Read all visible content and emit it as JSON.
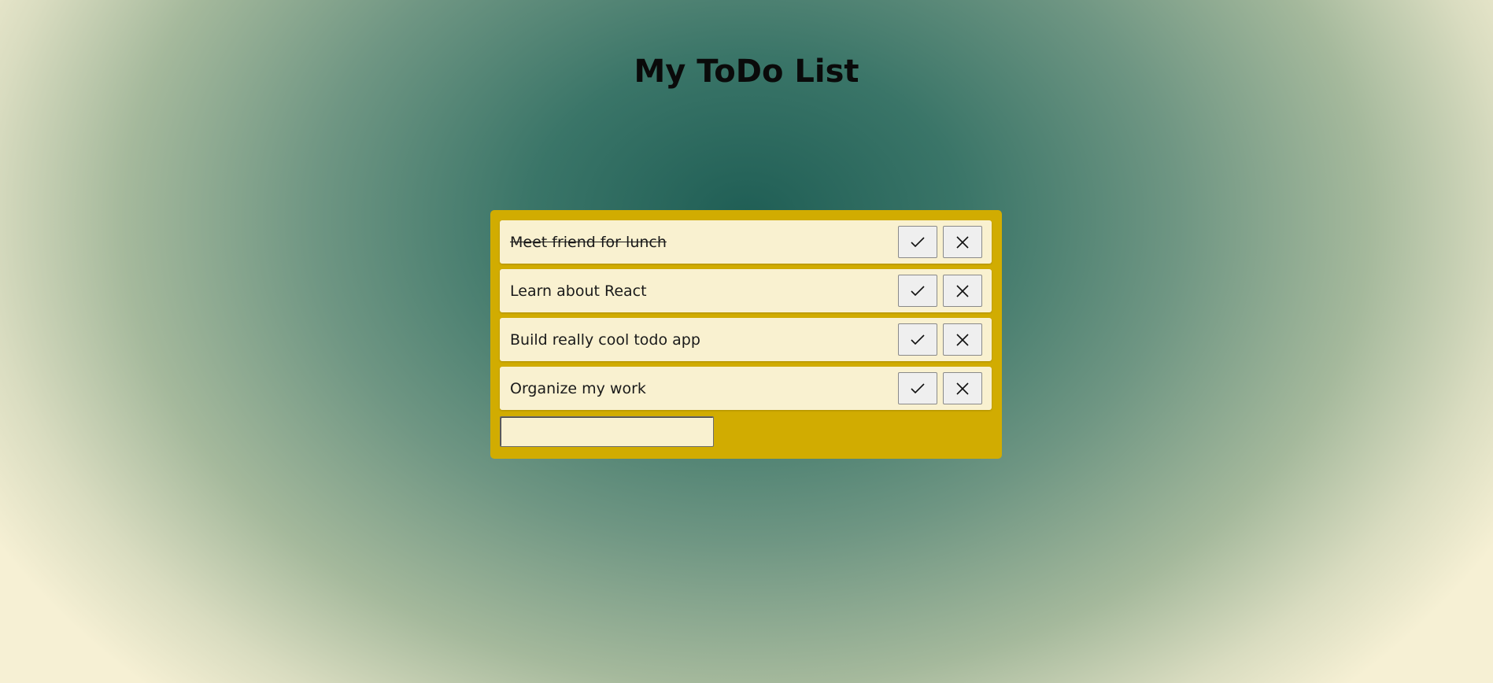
{
  "page": {
    "title": "My ToDo List"
  },
  "todos": [
    {
      "text": "Meet friend for lunch",
      "completed": true
    },
    {
      "text": "Learn about React",
      "completed": false
    },
    {
      "text": "Build really cool todo app",
      "completed": false
    },
    {
      "text": "Organize my work",
      "completed": false
    }
  ],
  "new_todo": {
    "value": "",
    "placeholder": ""
  },
  "icons": {
    "complete": "check-icon",
    "remove": "close-icon"
  },
  "colors": {
    "panel": "#d1ac01",
    "item_background": "#f9f1d0",
    "background_center": "#1f5e55",
    "background_edge": "#f6f0d4"
  }
}
